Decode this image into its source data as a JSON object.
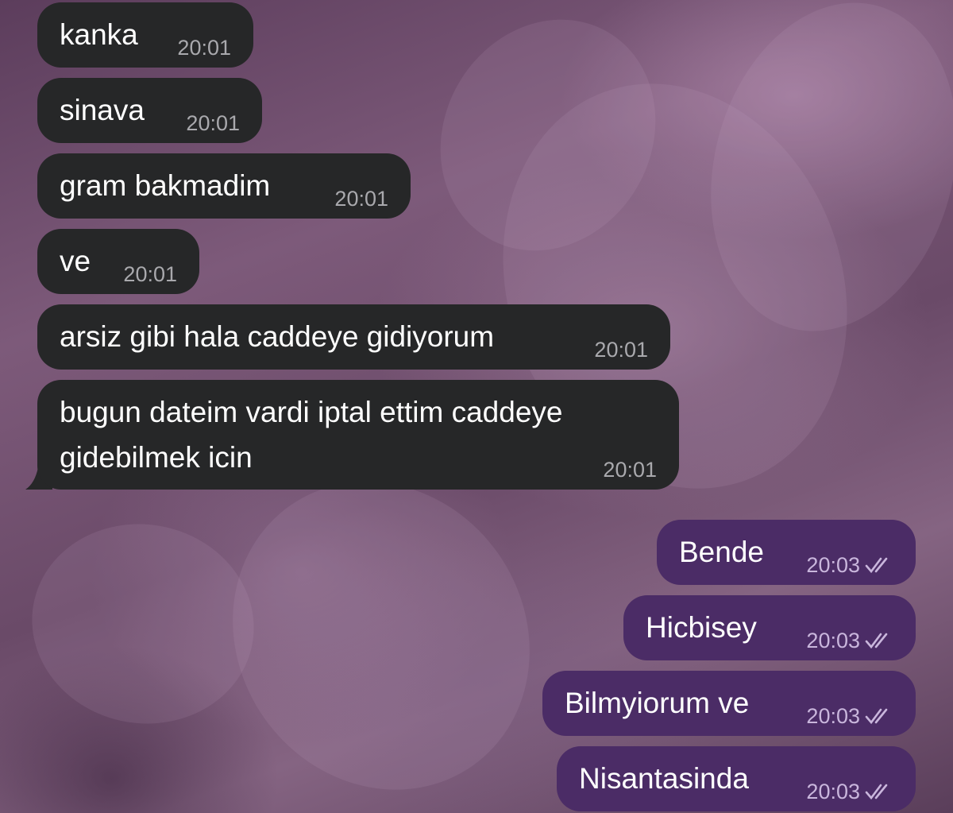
{
  "messages": [
    {
      "direction": "in",
      "text": "kanka",
      "time": "20:01"
    },
    {
      "direction": "in",
      "text": "sinava",
      "time": "20:01"
    },
    {
      "direction": "in",
      "text": "gram bakmadim",
      "time": "20:01"
    },
    {
      "direction": "in",
      "text": "ve",
      "time": "20:01"
    },
    {
      "direction": "in",
      "text": "arsiz gibi hala caddeye gidiyorum",
      "time": "20:01"
    },
    {
      "direction": "in",
      "text": "bugun dateim vardi iptal ettim caddeye gidebilmek icin",
      "time": "20:01"
    },
    {
      "direction": "out",
      "text": "Bende",
      "time": "20:03",
      "status": "read"
    },
    {
      "direction": "out",
      "text": "Hicbisey",
      "time": "20:03",
      "status": "read"
    },
    {
      "direction": "out",
      "text": "Bilmyiorum ve",
      "time": "20:03",
      "status": "read"
    },
    {
      "direction": "out",
      "text": "Nisantasinda",
      "time": "20:03",
      "status": "read"
    }
  ],
  "colors": {
    "incoming_bubble": "#262728",
    "outgoing_bubble": "#4b2c66",
    "wallpaper_tint": "#6e4c6a",
    "text": "#ffffff"
  },
  "icons": {
    "read_status": "double-check-icon"
  }
}
